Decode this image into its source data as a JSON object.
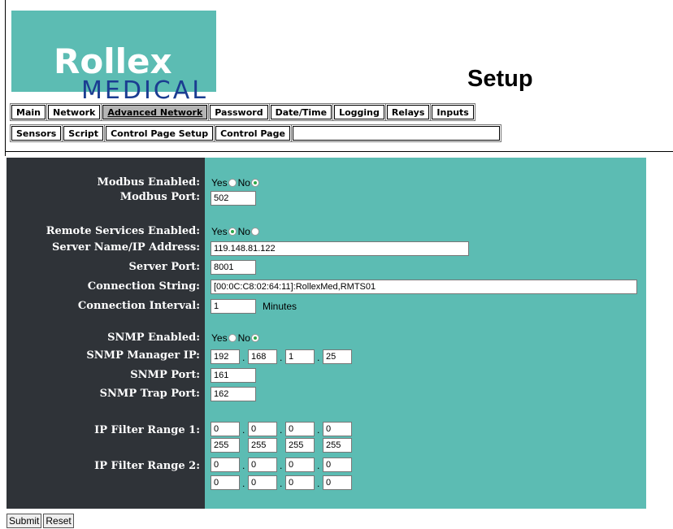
{
  "logo": {
    "word": "Rollex",
    "sub": "MEDICAL"
  },
  "title": "Setup",
  "tabs_row1": [
    "Main",
    "Network",
    "Advanced Network",
    "Password",
    "Date/Time",
    "Logging",
    "Relays",
    "Inputs"
  ],
  "tabs_row2": [
    "Sensors",
    "Script",
    "Control Page Setup",
    "Control Page"
  ],
  "active_tab": "Advanced Network",
  "form": {
    "modbus_enabled": {
      "label": "Modbus Enabled:",
      "yes": "Yes",
      "no": "No",
      "selected": "No"
    },
    "modbus_port": {
      "label": "Modbus Port:",
      "value": "502"
    },
    "remote_enabled": {
      "label": "Remote Services Enabled:",
      "yes": "Yes",
      "no": "No",
      "selected": "Yes"
    },
    "server_name": {
      "label": "Server Name/IP Address:",
      "value": "119.148.81.122"
    },
    "server_port": {
      "label": "Server Port:",
      "value": "8001"
    },
    "connection_string": {
      "label": "Connection String:",
      "value": "[00:0C:C8:02:64:11]:RollexMed,RMTS01"
    },
    "connection_interval": {
      "label": "Connection Interval:",
      "value": "1",
      "unit": "Minutes"
    },
    "snmp_enabled": {
      "label": "SNMP Enabled:",
      "yes": "Yes",
      "no": "No",
      "selected": "No"
    },
    "snmp_manager_ip": {
      "label": "SNMP Manager IP:",
      "octets": [
        "192",
        "168",
        "1",
        "25"
      ]
    },
    "snmp_port": {
      "label": "SNMP Port:",
      "value": "161"
    },
    "snmp_trap_port": {
      "label": "SNMP Trap Port:",
      "value": "162"
    },
    "ip_filter_1": {
      "label": "IP Filter Range 1:",
      "start": [
        "0",
        "0",
        "0",
        "0"
      ],
      "end": [
        "255",
        "255",
        "255",
        "255"
      ]
    },
    "ip_filter_2": {
      "label": "IP Filter Range 2:",
      "start": [
        "0",
        "0",
        "0",
        "0"
      ],
      "end": [
        "0",
        "0",
        "0",
        "0"
      ]
    }
  },
  "buttons": {
    "submit": "Submit",
    "reset": "Reset"
  },
  "colors": {
    "teal": "#5cbcb3",
    "dark": "#2f3338",
    "logo_blue": "#1b3d91",
    "radio_on": "#2ea84a"
  }
}
